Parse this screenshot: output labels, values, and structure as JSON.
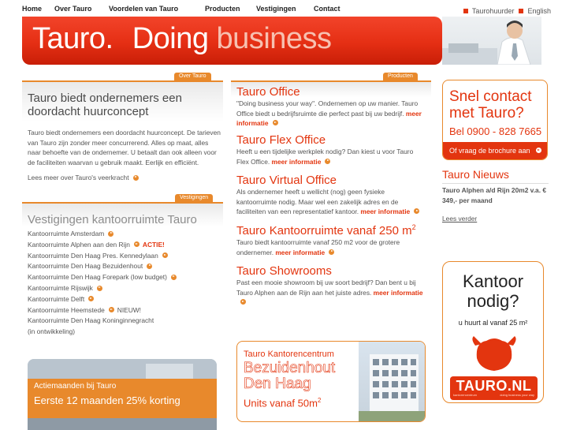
{
  "topnav": {
    "items": [
      "Home",
      "Over Tauro",
      "Voordelen van Tauro",
      "Producten",
      "Vestigingen",
      "Contact"
    ],
    "lang": [
      "Taurohuurder",
      "English"
    ]
  },
  "banner": {
    "word1": "Tauro.",
    "word2": "Doing",
    "word3": "business"
  },
  "left": {
    "tab1": "Over Tauro",
    "heading1": "Tauro biedt ondernemers een doordacht huurconcept",
    "intro": "Tauro biedt ondernemers een doordacht huurconcept. De tarieven van Tauro zijn zonder meer concurrerend. Alles op maat, alles naar behoefte van de ondernemer. U betaalt dan ook alleen voor de faciliteiten waarvan u gebruik maakt. Eerlijk en efficiënt.",
    "intro_link": "Lees meer over Tauro's veerkracht",
    "tab2": "Vestigingen",
    "heading2": "Vestigingen kantoorruimte Tauro",
    "locations": [
      {
        "label": "Kantoorruimte Amsterdam",
        "badge": ""
      },
      {
        "label": "Kantoorruimte Alphen aan den Rijn",
        "badge": "ACTIE!"
      },
      {
        "label": "Kantoorruimte Den Haag Pres. Kennedylaan",
        "badge": ""
      },
      {
        "label": "Kantoorruimte Den Haag Bezuidenhout",
        "badge": ""
      },
      {
        "label": "Kantoorruimte Den Haag Forepark (low budget)",
        "badge": ""
      },
      {
        "label": "Kantoorruimte Rijswijk",
        "badge": ""
      },
      {
        "label": "Kantoorruimte Delft",
        "badge": ""
      },
      {
        "label": "Kantoorruimte Heemstede",
        "badge": "NIEUW!"
      },
      {
        "label": "Kantoorruimte Den Haag Koninginnegracht",
        "badge": ""
      },
      {
        "label": "(in ontwikkeling)",
        "badge": ""
      }
    ],
    "promo_line1": "Actiemaanden bij Tauro",
    "promo_line2": "Eerste 12 maanden 25% korting"
  },
  "middle": {
    "tab": "Producten",
    "more": "meer informatie",
    "products": [
      {
        "title": "Tauro Office",
        "text": "\"Doing business your way\". Ondernemen op uw manier. Tauro Office biedt u bedrijfsruimte die perfect past bij uw bedrijf."
      },
      {
        "title": "Tauro Flex Office",
        "text": "Heeft u een tijdelijke werkplek nodig? Dan kiest u voor Tauro Flex Office."
      },
      {
        "title": "Tauro Virtual Office",
        "text": "Als ondernemer heeft u wellicht (nog) geen fysieke kantoorruimte nodig. Maar wel een zakelijk adres en de faciliteiten van een representatief kantoor."
      },
      {
        "title": "Tauro Kantoorruimte vanaf 250 m",
        "title_sup": "2",
        "text": "Tauro biedt kantoorruimte vanaf 250 m2 voor de grotere ondernemer."
      },
      {
        "title": "Tauro Showrooms",
        "text": "Past een mooie showroom bij uw soort bedrijf? Dan bent u bij Tauro Alphen aan de Rijn aan het juiste adres."
      }
    ],
    "promo": {
      "line1": "Tauro Kantorencentrum",
      "line2": "Bezuidenhout",
      "line3": "Den Haag",
      "line4": "Units vanaf 50m",
      "line4_sup": "2"
    }
  },
  "right": {
    "contact_title": "Snel contact met Tauro?",
    "contact_phone": "Bel 0900 - 828 7665",
    "contact_brochure": "Of vraag de brochure aan",
    "news_title": "Tauro Nieuws",
    "news_item": "Tauro Alphen a/d Rijn 20m2 v.a. € 349,- per maand",
    "news_more": "Lees verder",
    "ad_question": "Kantoor nodig?",
    "ad_sub": "u huurt al vanaf 25 m²",
    "ad_logo": "TAURO.NL",
    "ad_logo_left": "kantorencentrum",
    "ad_logo_right": "doing business your way"
  },
  "colors": {
    "accent_red": "#e3350f",
    "accent_orange": "#e8892c"
  }
}
